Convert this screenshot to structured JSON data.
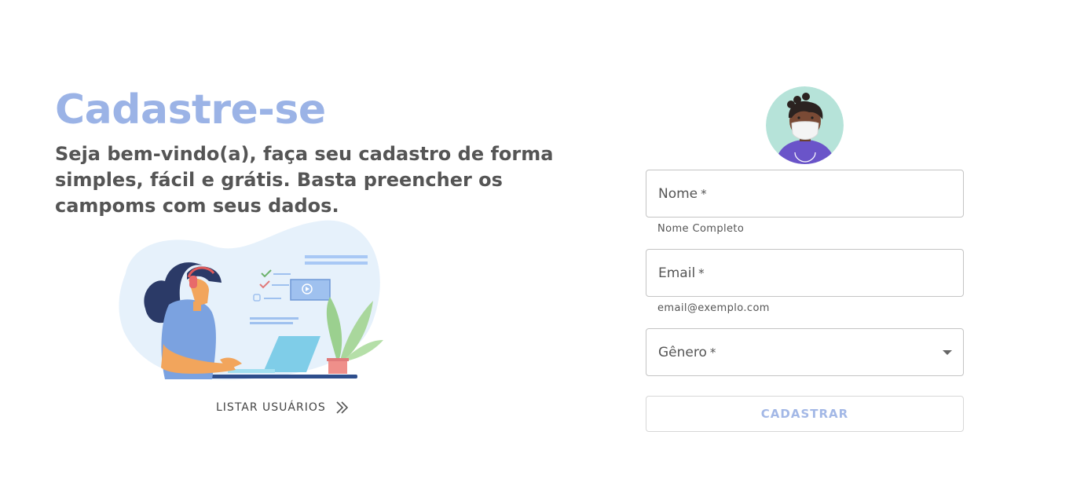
{
  "hero": {
    "title": "Cadastre-se",
    "subtitle": "Seja bem-vindo(a), faça seu cadastro de forma simples, fácil e grátis. Basta preencher os campoms com seus dados."
  },
  "list_link": {
    "label": "LISTAR USUÁRIOS",
    "icon": "double-chevron-right-icon"
  },
  "form": {
    "name": {
      "label": "Nome",
      "required_mark": "*",
      "helper": "Nome Completo",
      "value": ""
    },
    "email": {
      "label": "Email",
      "required_mark": "*",
      "helper": "email@exemplo.com",
      "value": ""
    },
    "gender": {
      "label": "Gênero",
      "required_mark": "*",
      "value": ""
    },
    "submit_label": "CADASTRAR"
  },
  "colors": {
    "accent": "#9bb3e6",
    "text": "#555555",
    "border": "#c4c4c4"
  }
}
